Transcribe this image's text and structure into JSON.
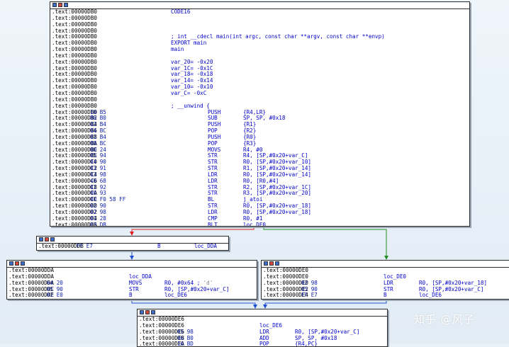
{
  "nodes": {
    "main": {
      "lines": [
        {
          "addr": ".text:00000DB0",
          "code": "CODE16"
        },
        {
          "addr": ".text:00000DB0"
        },
        {
          "addr": ".text:00000DB0"
        },
        {
          "addr": ".text:00000DB0"
        },
        {
          "addr": ".text:00000DB0",
          "code": "; int __cdecl main(int argc, const char **argv, const char **envp)"
        },
        {
          "addr": ".text:00000DB0",
          "code": "EXPORT main"
        },
        {
          "addr": ".text:00000DB0",
          "code": "main"
        },
        {
          "addr": ".text:00000DB0"
        },
        {
          "addr": ".text:00000DB0",
          "code": "var_20= -0x20"
        },
        {
          "addr": ".text:00000DB0",
          "code": "var_1C= -0x1C"
        },
        {
          "addr": ".text:00000DB0",
          "code": "var_18= -0x18"
        },
        {
          "addr": ".text:00000DB0",
          "code": "var_14= -0x14"
        },
        {
          "addr": ".text:00000DB0",
          "code": "var_10= -0x10"
        },
        {
          "addr": ".text:00000DB0",
          "code": "var_C= -0xC"
        },
        {
          "addr": ".text:00000DB0"
        },
        {
          "addr": ".text:00000DB0",
          "code": "; __unwind {"
        },
        {
          "addr": ".text:00000DB0",
          "bytes": "10 B5",
          "mn": "PUSH",
          "op": "{R4,LR}"
        },
        {
          "addr": ".text:00000DB2",
          "bytes": "86 B0",
          "mn": "SUB",
          "op": "SP, SP, #0x18"
        },
        {
          "addr": ".text:00000DB4",
          "bytes": "02 B4",
          "mn": "PUSH",
          "op": "{R1}"
        },
        {
          "addr": ".text:00000DB6",
          "bytes": "04 BC",
          "mn": "POP",
          "op": "{R2}"
        },
        {
          "addr": ".text:00000DB8",
          "bytes": "01 B4",
          "mn": "PUSH",
          "op": "{R0}"
        },
        {
          "addr": ".text:00000DBA",
          "bytes": "08 BC",
          "mn": "POP",
          "op": "{R3}"
        },
        {
          "addr": ".text:00000DBC",
          "bytes": "00 24",
          "mn": "MOVS",
          "op": "R4, #0"
        },
        {
          "addr": ".text:00000DBE",
          "bytes": "05 94",
          "mn": "STR",
          "op": "R4, [SP,#0x20+var_C]"
        },
        {
          "addr": ".text:00000DC0",
          "bytes": "04 90",
          "mn": "STR",
          "op": "R0, [SP,#0x20+var_10]"
        },
        {
          "addr": ".text:00000DC2",
          "bytes": "03 91",
          "mn": "STR",
          "op": "R1, [SP,#0x20+var_14]"
        },
        {
          "addr": ".text:00000DC4",
          "bytes": "03 98",
          "mn": "LDR",
          "op": "R0, [SP,#0x20+var_14]"
        },
        {
          "addr": ".text:00000DC6",
          "bytes": "40 68",
          "mn": "LDR",
          "op": "R0, [R0,#4]"
        },
        {
          "addr": ".text:00000DC8",
          "bytes": "01 92",
          "mn": "STR",
          "op": "R2, [SP,#0x20+var_1C]"
        },
        {
          "addr": ".text:00000DCA",
          "bytes": "00 93",
          "mn": "STR",
          "op": "R3, [SP,#0x20+var_20]"
        },
        {
          "addr": ".text:00000DCC",
          "bytes": "00 F0 58 FF",
          "mn": "BL",
          "op": "j_atoi"
        },
        {
          "addr": ".text:00000DD0",
          "bytes": "02 90",
          "mn": "STR",
          "op": "R0, [SP,#0x20+var_18]"
        },
        {
          "addr": ".text:00000DD2",
          "bytes": "02 98",
          "mn": "LDR",
          "op": "R0, [SP,#0x20+var_18]"
        },
        {
          "addr": ".text:00000DD4",
          "bytes": "01 28",
          "mn": "CMP",
          "op": "R0, #1"
        },
        {
          "addr": ".text:00000DD6",
          "bytes": "03 DB",
          "mn": "BLT",
          "op": "loc_DE0"
        }
      ]
    },
    "dd8": {
      "lines": [
        {
          "addr": ".text:00000DD8",
          "bytes": "FF E7",
          "mn": "B",
          "op": "loc_DDA"
        }
      ]
    },
    "dda": {
      "lines": [
        {
          "addr": ".text:00000DDA"
        },
        {
          "addr": ".text:00000DDA",
          "code": "loc_DDA"
        },
        {
          "addr": ".text:00000DDA",
          "bytes": "64 20",
          "mn": "MOVS",
          "op": "R0, #0x64 ;",
          "cmt": "'d'"
        },
        {
          "addr": ".text:00000DDC",
          "bytes": "05 90",
          "mn": "STR",
          "op": "R0, [SP,#0x20+var_C]"
        },
        {
          "addr": ".text:00000DDE",
          "bytes": "02 E0",
          "mn": "B",
          "op": "loc_DE6"
        }
      ]
    },
    "de0": {
      "lines": [
        {
          "addr": ".text:00000DE0"
        },
        {
          "addr": ".text:00000DE0",
          "code": "loc_DE0"
        },
        {
          "addr": ".text:00000DE0",
          "bytes": "02 98",
          "mn": "LDR",
          "op": "R0, [SP,#0x20+var_18]"
        },
        {
          "addr": ".text:00000DE2",
          "bytes": "05 90",
          "mn": "STR",
          "op": "R0, [SP,#0x20+var_C]"
        },
        {
          "addr": ".text:00000DE4",
          "bytes": "FF E7",
          "mn": "B",
          "op": "loc_DE6"
        }
      ]
    },
    "de6": {
      "lines": [
        {
          "addr": ".text:00000DE6"
        },
        {
          "addr": ".text:00000DE6",
          "code": "loc_DE6"
        },
        {
          "addr": ".text:00000DE6",
          "bytes": "05 98",
          "mn": "LDR",
          "op": "R0, [SP,#0x20+var_C]"
        },
        {
          "addr": ".text:00000DE8",
          "bytes": "06 B0",
          "mn": "ADD",
          "op": "SP, SP, #0x18"
        },
        {
          "addr": ".text:00000DEA",
          "bytes": "10 BD",
          "mn": "POP",
          "op": "{R4,PC}"
        }
      ]
    }
  },
  "edges": {
    "false_color": "#e02020",
    "true_color": "#209020",
    "uncond_color": "#2050d0"
  },
  "watermark": "知乎 @风子"
}
